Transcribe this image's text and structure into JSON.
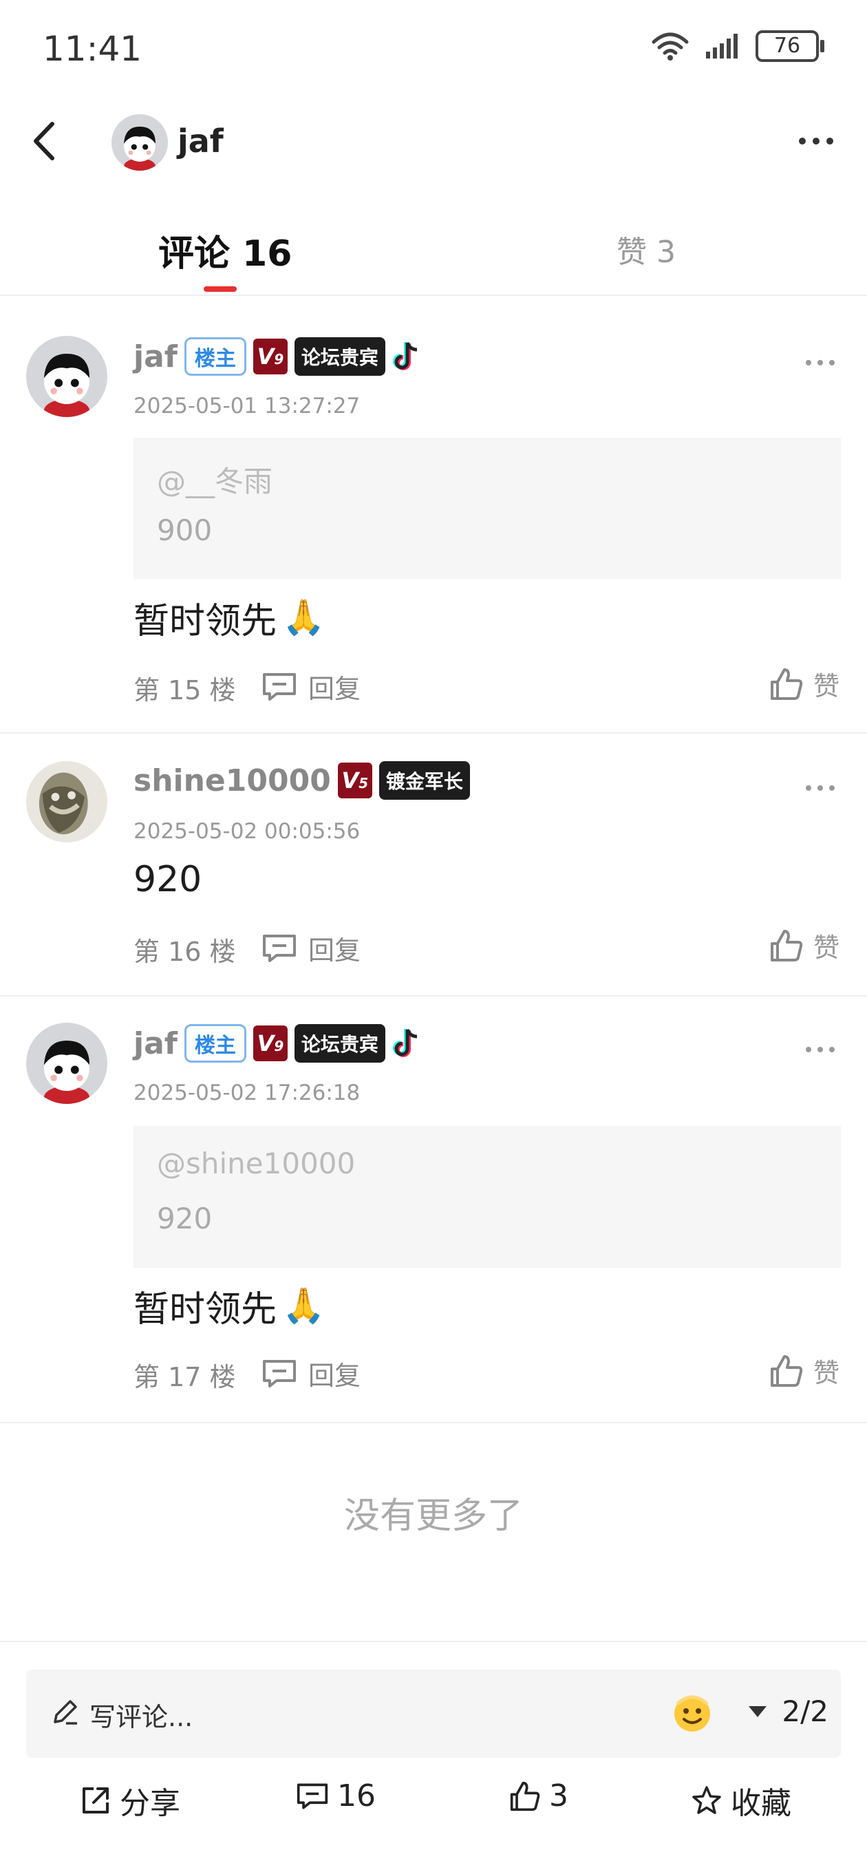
{
  "status_bar": {
    "time": "11:41",
    "battery": "76"
  },
  "header": {
    "username": "jaf"
  },
  "tabs": {
    "comments": "评论 16",
    "likes": "赞 3"
  },
  "comments": [
    {
      "name": "jaf",
      "host_badge": "楼主",
      "level": "V",
      "level_num": "9",
      "title_badge": "论坛贵宾",
      "time": "2025-05-01 13:27:27",
      "quote_user": "@__冬雨",
      "quote_text": "900",
      "text": "暂时领先",
      "floor": "第 15 楼",
      "reply": "回复",
      "like": "赞"
    },
    {
      "name": "shine10000",
      "level": "V",
      "level_num": "5",
      "title_badge": "镀金军长",
      "time": "2025-05-02 00:05:56",
      "text": "920",
      "floor": "第 16 楼",
      "reply": "回复",
      "like": "赞"
    },
    {
      "name": "jaf",
      "host_badge": "楼主",
      "level": "V",
      "level_num": "9",
      "title_badge": "论坛贵宾",
      "time": "2025-05-02 17:26:18",
      "quote_user": "@shine10000",
      "quote_text": "920",
      "text": "暂时领先",
      "floor": "第 17 楼",
      "reply": "回复",
      "like": "赞"
    }
  ],
  "end_text": "没有更多了",
  "input": {
    "placeholder": "写评论...",
    "page": "2/2"
  },
  "actions": {
    "share": "分享",
    "comments": "16",
    "likes": "3",
    "favorite": "收藏"
  },
  "colors": {
    "accent": "#e8312f",
    "host_badge": "#2f8ae6",
    "level_badge": "#8a0e1c"
  }
}
